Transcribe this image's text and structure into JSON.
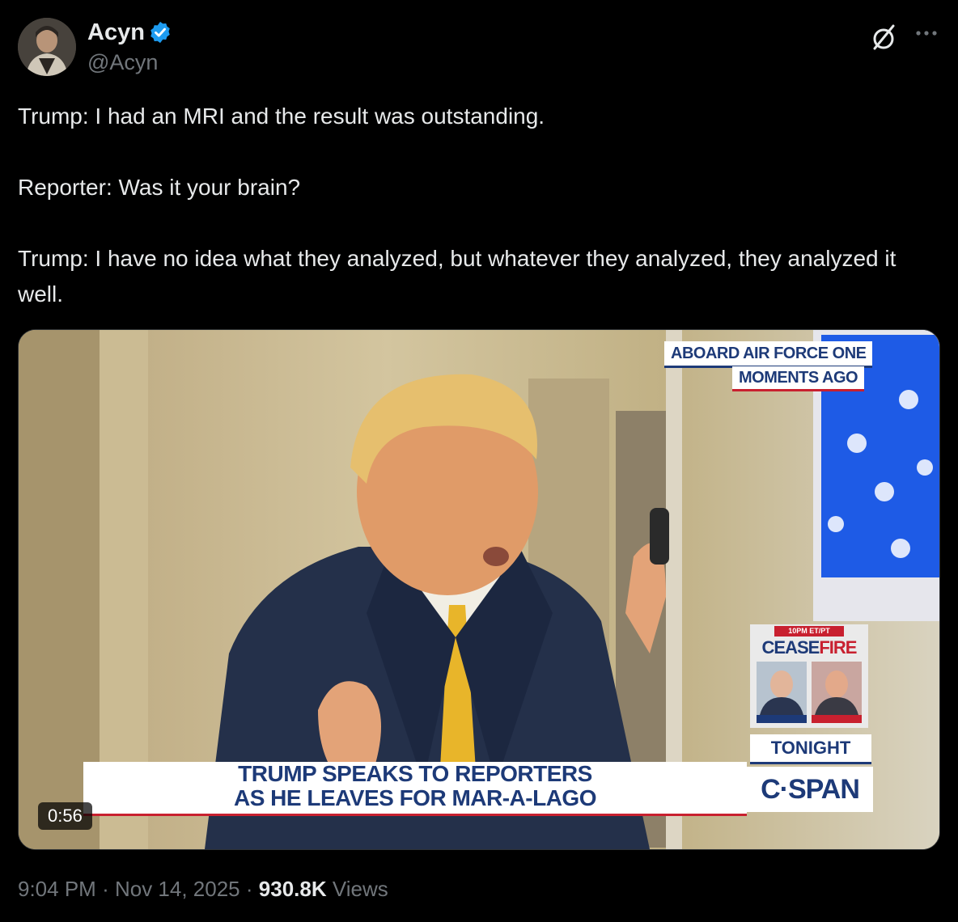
{
  "author": {
    "display_name": "Acyn",
    "handle": "@Acyn",
    "verified": true
  },
  "tweet": {
    "paragraphs": [
      "Trump: I had an MRI and the result was outstanding.",
      "Reporter: Was it your brain?",
      "Trump: I have no idea what they analyzed, but whatever they analyzed, they analyzed it well."
    ]
  },
  "video": {
    "duration": "0:56",
    "overlay": {
      "top_line": "ABOARD AIR FORCE ONE",
      "top_subline": "MOMENTS AGO",
      "headline_1": "TRUMP SPEAKS TO REPORTERS",
      "headline_2": "AS HE LEAVES FOR MAR-A-LAGO",
      "promo_time": "10PM ET/PT",
      "promo_title_a": "CEASE",
      "promo_title_b": "FIRE",
      "tonight": "TONIGHT",
      "network": "C·SPAN"
    }
  },
  "meta": {
    "time": "9:04 PM",
    "separator": "·",
    "date": "Nov 14, 2025",
    "views_count": "930.8K",
    "views_label": "Views"
  },
  "colors": {
    "background": "#000000",
    "text": "#e7e9ea",
    "secondary": "#71767b",
    "verified": "#1d9bf0",
    "cspan_blue": "#1d3a78",
    "cspan_red": "#c8202f"
  },
  "icons": [
    "verified-badge-icon",
    "grok-icon",
    "more-icon"
  ]
}
